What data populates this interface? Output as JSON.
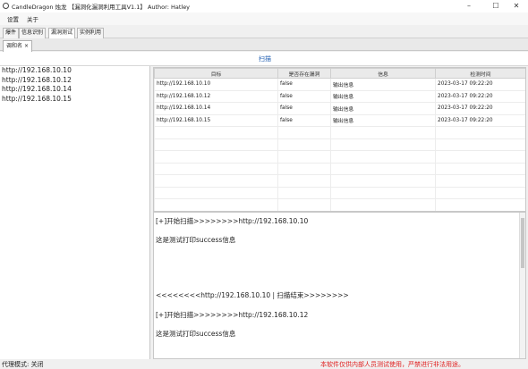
{
  "window": {
    "title": "CandleDragon 烛龙 【漏洞化漏洞利用工具V1.1】    Author:  Hatley",
    "minimize": "–",
    "maximize": "☐",
    "close": "✕"
  },
  "menu": [
    "设置",
    "关于"
  ],
  "top_tabs": [
    {
      "label": "爆件"
    },
    {
      "label": "信息识别"
    },
    {
      "label": "漏洞测试"
    },
    {
      "label": "实例利用"
    }
  ],
  "doc_tab": {
    "label": "调和名",
    "close": "×"
  },
  "scan_button": "扫描",
  "targets": [
    "http://192.168.10.10",
    "http://192.168.10.12",
    "http://192.168.10.14",
    "http://192.168.10.15"
  ],
  "table": {
    "headers": [
      "目标",
      "是否存在漏洞",
      "信息",
      "检测时间"
    ],
    "rows": [
      [
        "http://192.168.10.10",
        "false",
        "输出信息",
        "2023-03-17 09:22:20"
      ],
      [
        "http://192.168.10.12",
        "false",
        "输出信息",
        "2023-03-17 09:22:20"
      ],
      [
        "http://192.168.10.14",
        "false",
        "输出信息",
        "2023-03-17 09:22:20"
      ],
      [
        "http://192.168.10.15",
        "false",
        "输出信息",
        "2023-03-17 09:22:20"
      ],
      [
        "",
        "",
        "",
        ""
      ],
      [
        "",
        "",
        "",
        ""
      ],
      [
        "",
        "",
        "",
        ""
      ],
      [
        "",
        "",
        "",
        ""
      ],
      [
        "",
        "",
        "",
        ""
      ],
      [
        "",
        "",
        "",
        ""
      ],
      [
        "",
        "",
        "",
        ""
      ]
    ]
  },
  "log": [
    "[+]开始扫描>>>>>>>>http://192.168.10.10",
    "这是测试打印success信息",
    "<<<<<<<<http://192.168.10.10  |  扫描结束>>>>>>>>",
    "[+]开始扫描>>>>>>>>http://192.168.10.12",
    "这是测试打印success信息"
  ],
  "status": {
    "proxy": "代理模式: 关闭",
    "warning": "本软件仅供内部人员测试使用，严禁进行非法用途。"
  }
}
